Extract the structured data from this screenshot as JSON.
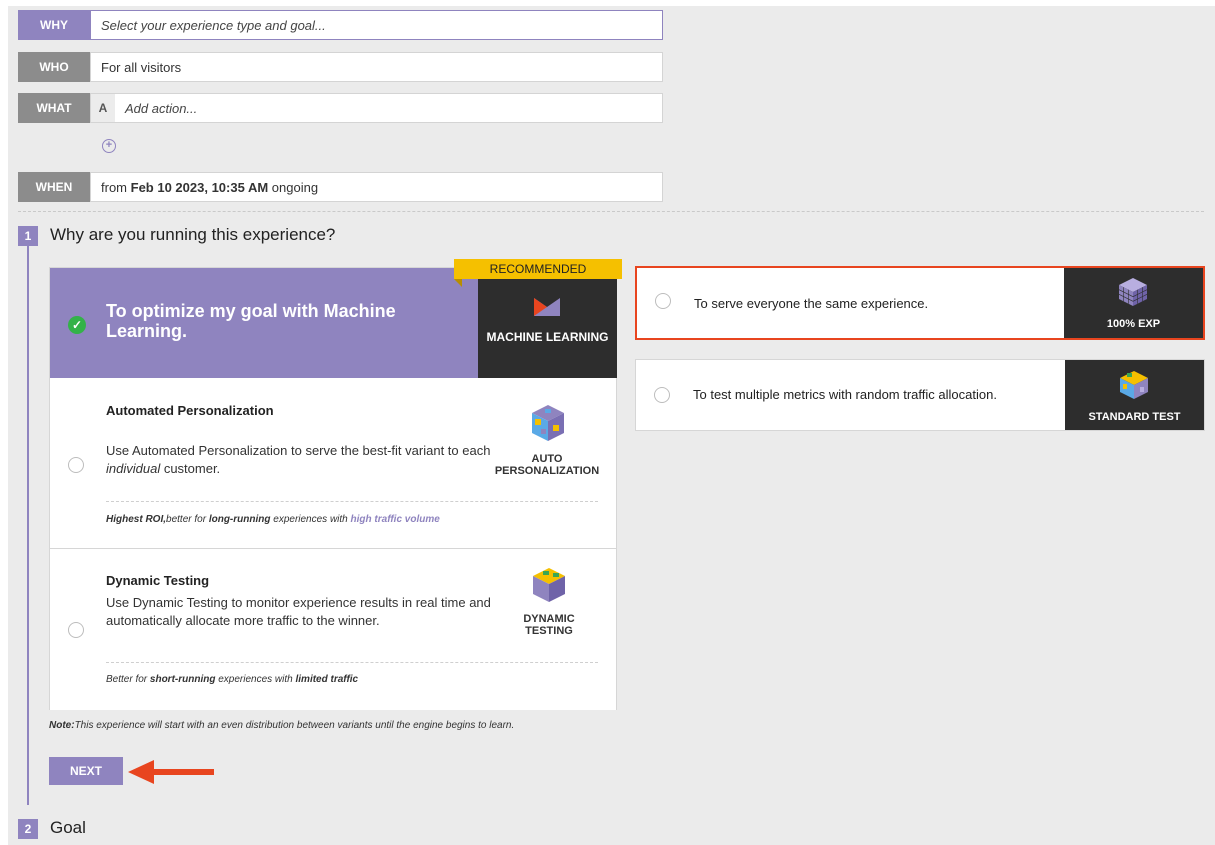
{
  "summary": {
    "why": {
      "label": "WHY",
      "placeholder": "Select your experience type and goal..."
    },
    "who": {
      "label": "WHO",
      "value": "For all visitors"
    },
    "what": {
      "label": "WHAT",
      "variant": "A",
      "placeholder": "Add action..."
    },
    "add_icon": "plus-circle-icon",
    "when": {
      "label": "WHEN",
      "prefix": "from ",
      "date": "Feb 10 2023, 10:35 AM",
      "suffix": " ongoing"
    }
  },
  "step1": {
    "number": "1",
    "title": "Why are you running this experience?"
  },
  "ml_card": {
    "recommended": "RECOMMENDED",
    "title": "To optimize my goal with Machine Learning.",
    "badge": "MACHINE LEARNING",
    "check_icon": "check-circle-icon",
    "options": [
      {
        "title": "Automated Personalization",
        "desc_1": "Use Automated Personalization to serve the best-fit variant to each ",
        "desc_italic": "individual",
        "desc_2": " customer.",
        "icon_label_1": "AUTO",
        "icon_label_2": "PERSONALIZATION",
        "foot_b1": "Highest ROI,",
        "foot_t1": "better for ",
        "foot_b2": "long-running",
        "foot_t2": " experiences with ",
        "foot_hl": "high traffic volume"
      },
      {
        "title": "Dynamic Testing",
        "desc": "Use Dynamic Testing to monitor experience results in real time and automatically allocate more traffic to the winner.",
        "icon_label_1": "DYNAMIC",
        "icon_label_2": "TESTING",
        "foot_t1": "Better for ",
        "foot_b1": "short-running",
        "foot_t2": " experiences with ",
        "foot_b2": "limited traffic"
      }
    ]
  },
  "note": {
    "bold": "Note:",
    "text": "This experience will start with an even distribution between variants until the engine begins to learn."
  },
  "next_label": "NEXT",
  "right_cards": [
    {
      "text": "To serve everyone the same experience.",
      "badge": "100% EXP",
      "selected": true
    },
    {
      "text": "To test multiple metrics with random traffic allocation.",
      "badge": "STANDARD TEST",
      "selected": false
    }
  ],
  "step2": {
    "number": "2",
    "title": "Goal"
  },
  "colors": {
    "accent": "#8f84bf",
    "highlight": "#e8451f",
    "recommended": "#f5c000",
    "dark": "#2d2d2d",
    "check": "#33b249"
  }
}
